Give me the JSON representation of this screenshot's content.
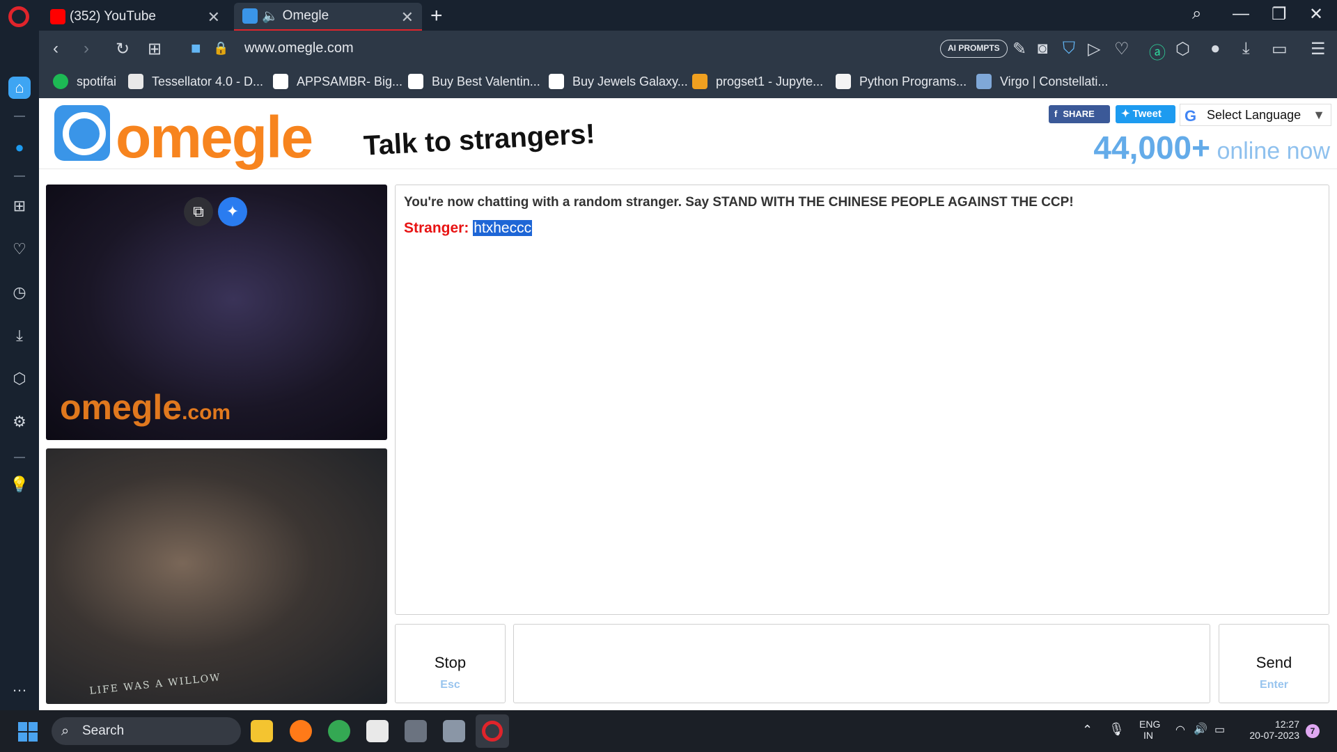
{
  "browser": {
    "tabs": [
      {
        "title": "(352) YouTube",
        "favicon": "youtube-icon",
        "active": false
      },
      {
        "title": "Omegle",
        "favicon": "omegle-icon",
        "active": true
      }
    ],
    "url": "www.omegle.com",
    "ai_prompts_label": "AI PROMPTS"
  },
  "bookmarks": [
    {
      "label": "spotifai",
      "icon": "spotify-icon"
    },
    {
      "label": "Tessellator 4.0 - D...",
      "icon": "tu-icon"
    },
    {
      "label": "APPSAMBR- Big...",
      "icon": "amazon-icon"
    },
    {
      "label": "Buy Best Valentin...",
      "icon": "amazon-icon"
    },
    {
      "label": "Buy Jewels Galaxy...",
      "icon": "amazon-icon"
    },
    {
      "label": "progset1 - Jupyte...",
      "icon": "jupyter-icon"
    },
    {
      "label": "Python Programs...",
      "icon": "yn-icon"
    },
    {
      "label": "Virgo | Constellati...",
      "icon": "virgo-icon"
    }
  ],
  "omegle": {
    "logo": "omegle",
    "tagline": "Talk to strangers!",
    "share_label": "SHARE",
    "tweet_label": "Tweet",
    "language_label": "Select Language",
    "online_count": "44,000+",
    "online_text": "online now",
    "watermark": "omegle",
    "watermark_suffix": ".com",
    "shirt_text": "LIFE WAS A WILLOW",
    "status": "You're now chatting with a random stranger. Say STAND WITH THE CHINESE PEOPLE AGAINST THE CCP!",
    "messages": [
      {
        "sender": "Stranger:",
        "text": "htxheccc"
      }
    ],
    "stop_label": "Stop",
    "stop_hint": "Esc",
    "send_label": "Send",
    "send_hint": "Enter",
    "message_value": ""
  },
  "taskbar": {
    "search_label": "Search",
    "lang_top": "ENG",
    "lang_bottom": "IN",
    "time": "12:27",
    "date": "20-07-2023",
    "notifications": "7"
  },
  "colors": {
    "omegle_orange": "#f7841e",
    "omegle_blue": "#3a95e8",
    "stranger_red": "#e81313",
    "opera_red": "#e0242b"
  }
}
